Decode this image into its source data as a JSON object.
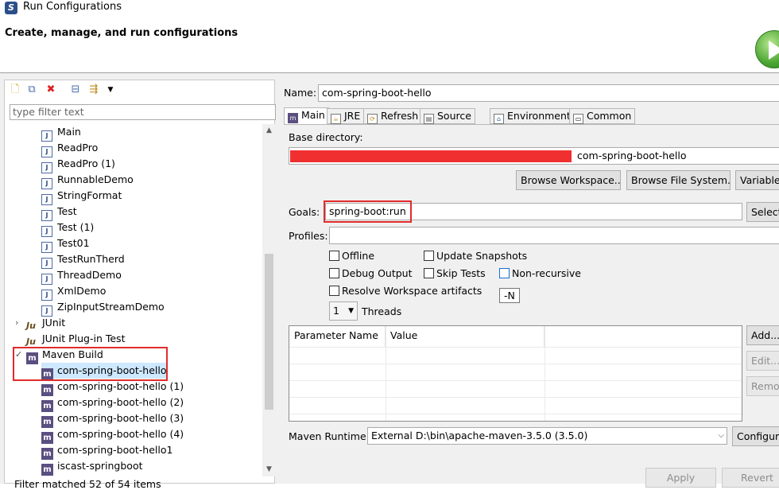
{
  "window": {
    "title": "Run Configurations"
  },
  "header": {
    "title": "Create, manage, and run configurations"
  },
  "filter": {
    "placeholder": "type filter text",
    "status": "Filter matched 52 of 54 items"
  },
  "tree": [
    {
      "label": "Main",
      "icon": "java-app-icon",
      "indent": 1
    },
    {
      "label": "ReadPro",
      "icon": "java-app-icon",
      "indent": 1
    },
    {
      "label": "ReadPro (1)",
      "icon": "java-app-icon",
      "indent": 1
    },
    {
      "label": "RunnableDemo",
      "icon": "java-app-icon",
      "indent": 1
    },
    {
      "label": "StringFormat",
      "icon": "java-app-icon",
      "indent": 1
    },
    {
      "label": "Test",
      "icon": "java-app-icon",
      "indent": 1
    },
    {
      "label": "Test (1)",
      "icon": "java-app-icon",
      "indent": 1
    },
    {
      "label": "Test01",
      "icon": "java-app-icon",
      "indent": 1
    },
    {
      "label": "TestRunTherd",
      "icon": "java-app-icon",
      "indent": 1
    },
    {
      "label": "ThreadDemo",
      "icon": "java-app-icon",
      "indent": 1
    },
    {
      "label": "XmlDemo",
      "icon": "java-app-icon",
      "indent": 1
    },
    {
      "label": "ZipInputStreamDemo",
      "icon": "java-app-icon",
      "indent": 1
    },
    {
      "label": "JUnit",
      "icon": "junit-icon",
      "indent": 0,
      "arrow": "collapsed"
    },
    {
      "label": "JUnit Plug-in Test",
      "icon": "junit-plugin-icon",
      "indent": 0
    },
    {
      "label": "Maven Build",
      "icon": "maven-icon",
      "indent": 0,
      "arrow": "expanded"
    },
    {
      "label": "com-spring-boot-hello",
      "icon": "maven-icon",
      "indent": 1,
      "selected": true
    },
    {
      "label": "com-spring-boot-hello (1)",
      "icon": "maven-icon",
      "indent": 1
    },
    {
      "label": "com-spring-boot-hello (2)",
      "icon": "maven-icon",
      "indent": 1
    },
    {
      "label": "com-spring-boot-hello (3)",
      "icon": "maven-icon",
      "indent": 1
    },
    {
      "label": "com-spring-boot-hello (4)",
      "icon": "maven-icon",
      "indent": 1
    },
    {
      "label": "com-spring-boot-hello1",
      "icon": "maven-icon",
      "indent": 1
    },
    {
      "label": "iscast-springboot",
      "icon": "maven-icon",
      "indent": 1
    }
  ],
  "config": {
    "name_label": "Name:",
    "name_value": "com-spring-boot-hello",
    "tabs": [
      {
        "label": "Main",
        "icon": "maven-main-icon",
        "active": true
      },
      {
        "label": "JRE",
        "icon": "jre-icon"
      },
      {
        "label": "Refresh",
        "icon": "refresh-icon"
      },
      {
        "label": "Source",
        "icon": "source-icon"
      },
      {
        "label": "Environment",
        "icon": "environment-icon"
      },
      {
        "label": "Common",
        "icon": "common-icon"
      }
    ],
    "base_dir_label": "Base directory:",
    "base_dir_value": "com-spring-boot-hello",
    "browse_workspace": "Browse Workspace...",
    "browse_filesystem": "Browse File System...",
    "variables": "Variables...",
    "goals_label": "Goals:",
    "goals_value": "spring-boot:run",
    "select_button": "Select...",
    "profiles_label": "Profiles:",
    "profiles_value": "",
    "checkboxes": {
      "offline": "Offline",
      "update_snapshots": "Update Snapshots",
      "debug_output": "Debug Output",
      "skip_tests": "Skip Tests",
      "non_recursive": "Non-recursive",
      "resolve_workspace": "Resolve Workspace artifacts"
    },
    "tooltip": "-N",
    "threads_value": "1",
    "threads_label": "Threads",
    "param_col1": "Parameter Name",
    "param_col2": "Value",
    "add_button": "Add...",
    "edit_button": "Edit...",
    "remove_button": "Remove",
    "runtime_label": "Maven Runtime:",
    "runtime_value": "External D:\\bin\\apache-maven-3.5.0 (3.5.0)",
    "configure_button": "Configure...",
    "apply_button": "Apply",
    "revert_button": "Revert"
  }
}
